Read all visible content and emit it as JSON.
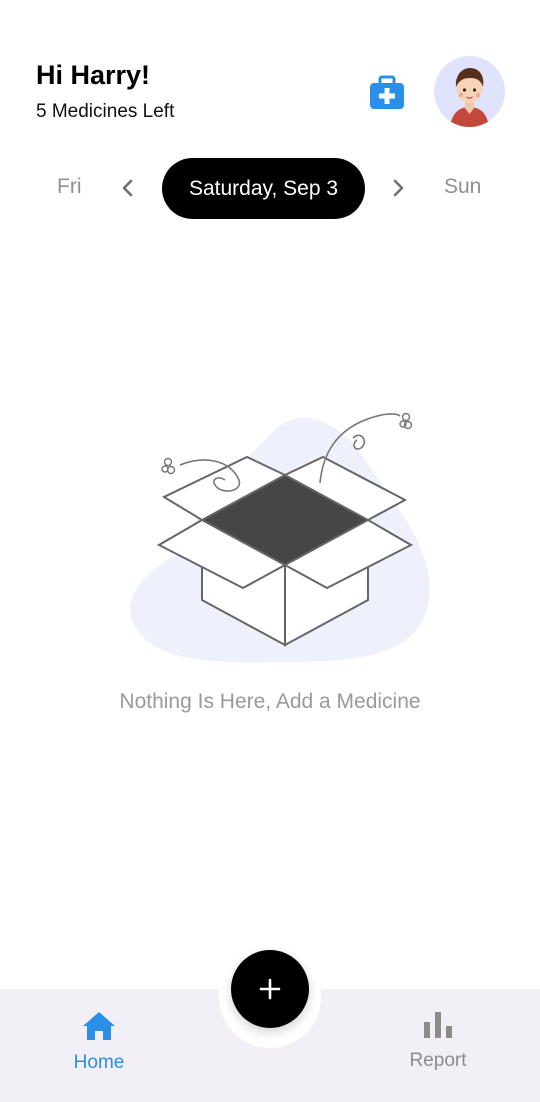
{
  "header": {
    "greeting": "Hi Harry!",
    "subtitle": "5 Medicines Left",
    "kit_icon": "medical-kit-icon",
    "avatar_icon": "user-avatar"
  },
  "date_nav": {
    "prev_day": "Fri",
    "current_date": "Saturday, Sep 3",
    "next_day": "Sun"
  },
  "empty_state": {
    "message": "Nothing Is Here, Add a Medicine",
    "illustration": "open-box-illustration"
  },
  "bottom_nav": {
    "items": [
      {
        "label": "Home",
        "icon": "home-icon",
        "active": true
      },
      {
        "label": "Report",
        "icon": "bar-chart-icon",
        "active": false
      }
    ],
    "fab_icon": "plus-icon"
  },
  "colors": {
    "accent": "#2a8fe6",
    "inactive": "#8c8c8c",
    "nav_background": "#f2eff6",
    "pill": "#000000"
  }
}
